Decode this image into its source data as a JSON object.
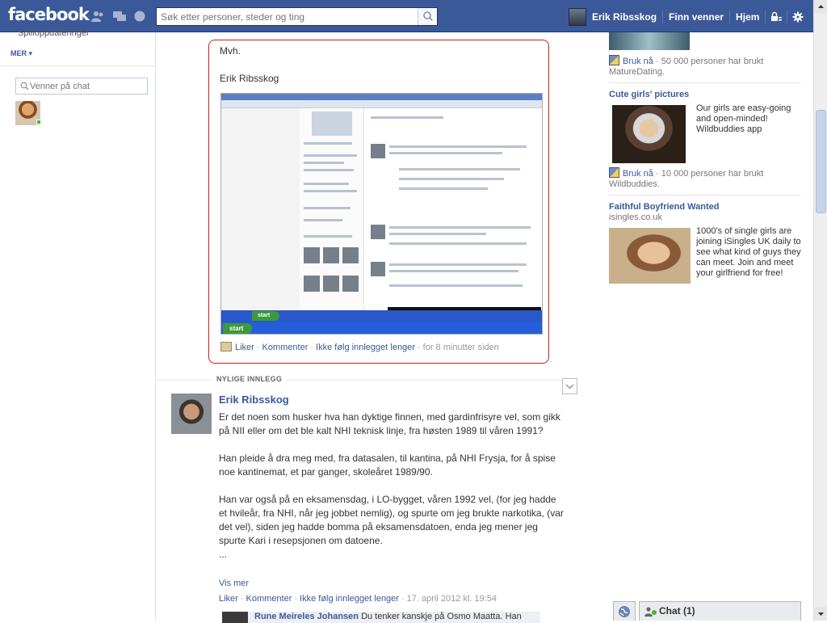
{
  "topbar": {
    "logo": "facebook",
    "search_placeholder": "Søk etter personer, steder og ting",
    "user_name": "Erik Ribsskog",
    "find_friends": "Finn venner",
    "home": "Hjem"
  },
  "left": {
    "cut_item": "Spilloppdateringer",
    "more": "MER",
    "chat_search_placeholder": "Venner på chat"
  },
  "photo_post": {
    "line1": "Mvh.",
    "line2": "Erik Ribsskog",
    "screenshot": {
      "start_label": "start"
    },
    "actions": {
      "like": "Liker",
      "comment": "Kommenter",
      "unfollow": "Ikke følg innlegget lenger",
      "time": "for 8 minutter siden"
    }
  },
  "recent": {
    "label": "NYLIGE INNLEGG"
  },
  "post": {
    "author": "Erik Ribsskog",
    "paragraphs": [
      "Er det noen som husker hva han dyktige finnen, med gardinfrisyre vel, som gikk på NII eller om det ble kalt NHI teknisk linje, fra høsten 1989 til våren 1991?",
      "Han pleide å dra meg med, fra datasalen, til kantina, på NHI Frysja, for å spise noe kantinemat, et par ganger, skoleåret 1989/90.",
      "Han var også på en eksamensdag, i LO-bygget, våren 1992 vel, (for jeg hadde et hvileår, fra NHI, når jeg jobbet nemlig), og spurte om jeg brukte narkotika, (var det vel), siden jeg hadde bomma på eksamensdatoen, enda jeg mener jeg spurte Kari i resepsjonen om datoene."
    ],
    "ellipsis": "...",
    "see_more": "Vis mer",
    "actions": {
      "like": "Liker",
      "comment": "Kommenter",
      "unfollow": "Ikke følg innlegget lenger",
      "time": "17. april 2012 kl. 19:54"
    },
    "comment": {
      "author": "Rune Meireles Johansen",
      "text": "Du tenker kanskje på Osmo Maatta. Han"
    }
  },
  "ads": [
    {
      "like_link": "Bruk nå",
      "like_text": "· 50 000 personer har brukt MatureDating."
    },
    {
      "title": "Cute girls' pictures",
      "text": "Our girls are easy-going and open-minded! Wildbuddies app",
      "like_link": "Bruk nå",
      "like_text": "· 10 000 personer har brukt Wildbuddies."
    },
    {
      "title": "Faithful Boyfriend Wanted",
      "sub": "isingles.co.uk",
      "text": "1000's of single girls are joining iSingles UK daily to see what kind of guys they can meet. Join and meet your girlfriend for free!"
    }
  ],
  "chat_dock": {
    "label": "Chat (1)"
  },
  "colors": {
    "brand": "#3b5998",
    "highlight_border": "#c81e1e",
    "online": "#42b72a"
  }
}
